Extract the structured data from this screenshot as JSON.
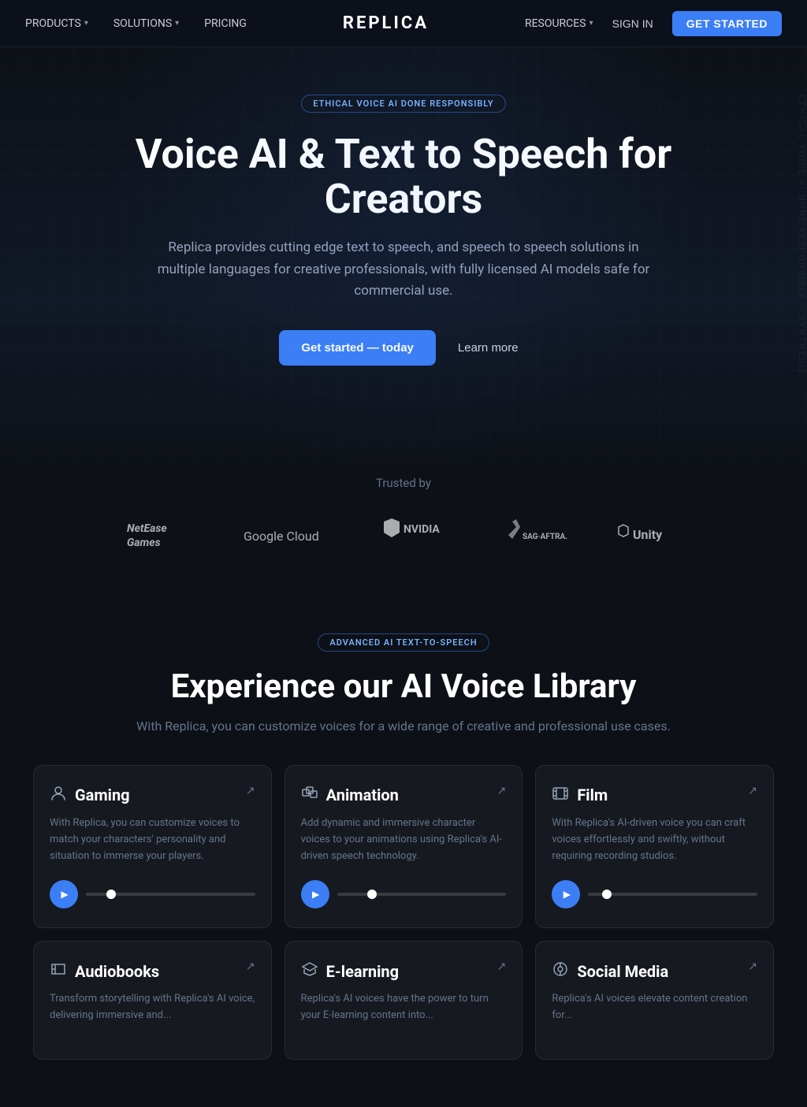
{
  "nav": {
    "logo": "REPLICA",
    "left_items": [
      {
        "label": "PRODUCTS",
        "has_chevron": true
      },
      {
        "label": "SOLUTIONS",
        "has_chevron": true
      },
      {
        "label": "PRICING",
        "has_chevron": false
      }
    ],
    "right_items": [
      {
        "label": "RESOURCES",
        "has_chevron": true
      },
      {
        "label": "SIGN IN",
        "has_chevron": false
      }
    ],
    "cta_label": "GET STARTED"
  },
  "hero": {
    "badge": "ETHICAL VOICE AI DONE RESPONSIBLY",
    "title": "Voice AI & Text to Speech for Creators",
    "subtitle": "Replica provides cutting edge text to speech, and speech to speech solutions in multiple languages for creative professionals, with fully licensed AI models safe for commercial use.",
    "cta_primary": "Get started — today",
    "cta_secondary": "Learn more"
  },
  "trusted": {
    "label": "Trusted by",
    "logos": [
      {
        "name": "NetEase Games",
        "style": "netease"
      },
      {
        "name": "Google Cloud",
        "style": "google"
      },
      {
        "name": "NVIDIA",
        "style": "nvidia"
      },
      {
        "name": "SAG·AFTRA",
        "style": "sagaftra"
      },
      {
        "name": "Unity",
        "style": "unity"
      }
    ]
  },
  "voice_library": {
    "badge": "ADVANCED AI TEXT-TO-SPEECH",
    "title": "Experience our AI Voice Library",
    "subtitle": "With Replica, you can customize voices for a wide range of creative and professional use cases.",
    "cards": [
      {
        "id": "gaming",
        "icon": "👤",
        "title": "Gaming",
        "description": "With Replica, you can customize voices to match your characters' personality and situation to immerse your players."
      },
      {
        "id": "animation",
        "icon": "◈",
        "title": "Animation",
        "description": "Add dynamic and immersive character voices to your animations using Replica's AI-driven speech technology."
      },
      {
        "id": "film",
        "icon": "▦",
        "title": "Film",
        "description": "With Replica's AI-driven voice you can craft voices effortlessly and swiftly, without requiring recording studios."
      },
      {
        "id": "audiobooks",
        "icon": "📖",
        "title": "Audiobooks",
        "description": "Transform storytelling with Replica's AI voice, delivering immersive and..."
      },
      {
        "id": "elearning",
        "icon": "🎓",
        "title": "E-learning",
        "description": "Replica's AI voices have the power to turn your E-learning content into..."
      },
      {
        "id": "social-media",
        "icon": "📻",
        "title": "Social Media",
        "description": "Replica's AI voices elevate content creation for..."
      }
    ]
  },
  "watermark": "ETHICAL VOICE AI DONE RESPONSIBLY — SYNTHESIS"
}
